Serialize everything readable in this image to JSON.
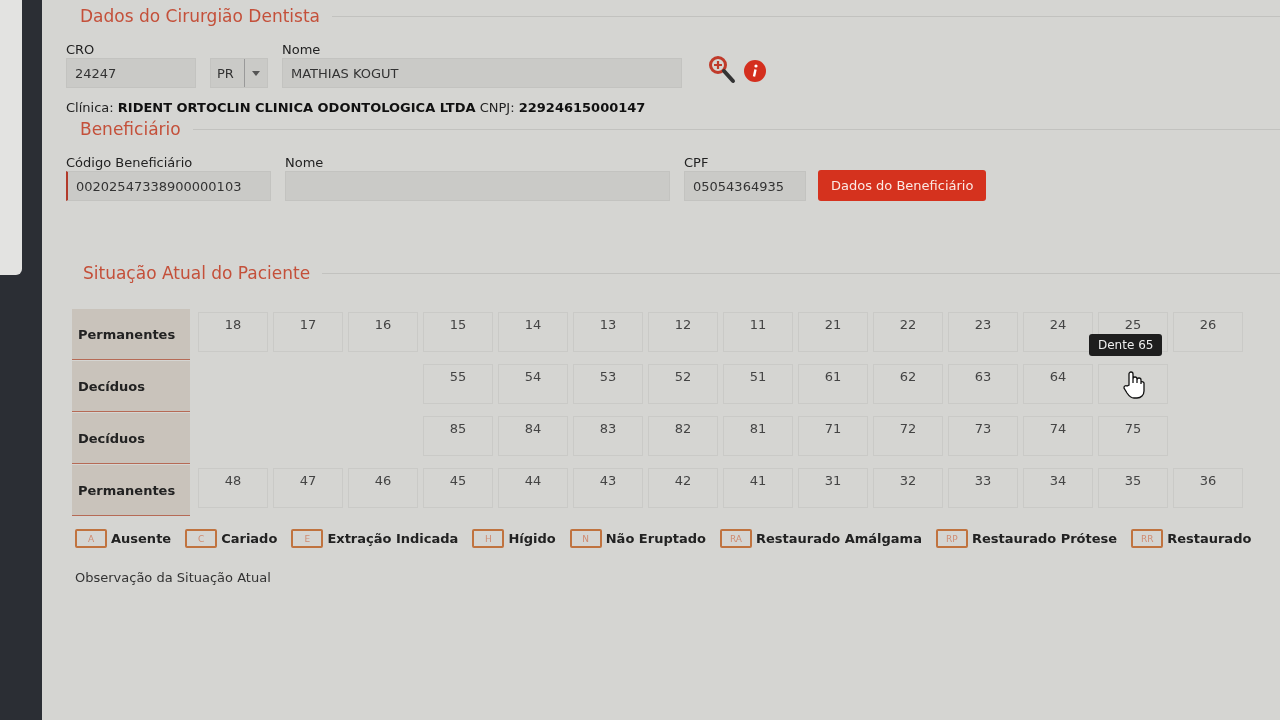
{
  "dentist_section": {
    "title": "Dados do Cirurgião Dentista",
    "cro": {
      "label": "CRO",
      "value": "24247"
    },
    "uf": {
      "value": "PR"
    },
    "name": {
      "label": "Nome",
      "value": "MATHIAS KOGUT"
    },
    "clinic_label": "Clínica:",
    "clinic_name": "RIDENT ORTOCLIN CLINICA ODONTOLOGICA LTDA",
    "cnpj_label": "CNPJ:",
    "cnpj": "22924615000147"
  },
  "beneficiary_section": {
    "title": "Beneficiário",
    "code": {
      "label": "Código Beneficiário",
      "value": "00202547338900000103"
    },
    "name": {
      "label": "Nome"
    },
    "cpf": {
      "label": "CPF",
      "value": "05054364935"
    },
    "button": "Dados do Beneficiário"
  },
  "patient_section": {
    "title": "Situação Atual do Paciente",
    "rows": [
      {
        "label": "Permanentes",
        "cells": [
          {
            "kind": "tooth",
            "number": "18"
          },
          {
            "kind": "tooth",
            "number": "17"
          },
          {
            "kind": "tooth",
            "number": "16"
          },
          {
            "kind": "tooth",
            "number": "15"
          },
          {
            "kind": "tooth",
            "number": "14"
          },
          {
            "kind": "tooth",
            "number": "13"
          },
          {
            "kind": "tooth",
            "number": "12"
          },
          {
            "kind": "tooth",
            "number": "11"
          },
          {
            "kind": "tooth",
            "number": "21"
          },
          {
            "kind": "tooth",
            "number": "22"
          },
          {
            "kind": "tooth",
            "number": "23"
          },
          {
            "kind": "tooth",
            "number": "24"
          },
          {
            "kind": "tooth",
            "number": "25"
          },
          {
            "kind": "tooth",
            "number": "26"
          }
        ]
      },
      {
        "label": "Decíduos",
        "cells": [
          {
            "kind": "empty"
          },
          {
            "kind": "empty"
          },
          {
            "kind": "empty"
          },
          {
            "kind": "tooth",
            "number": "55"
          },
          {
            "kind": "tooth",
            "number": "54"
          },
          {
            "kind": "tooth",
            "number": "53"
          },
          {
            "kind": "tooth",
            "number": "52"
          },
          {
            "kind": "tooth",
            "number": "51"
          },
          {
            "kind": "tooth",
            "number": "61"
          },
          {
            "kind": "tooth",
            "number": "62"
          },
          {
            "kind": "tooth",
            "number": "63"
          },
          {
            "kind": "tooth",
            "number": "64"
          },
          {
            "kind": "hovered",
            "tooltip": "Dente 65"
          },
          {
            "kind": "empty"
          }
        ]
      },
      {
        "label": "Decíduos",
        "cells": [
          {
            "kind": "empty"
          },
          {
            "kind": "empty"
          },
          {
            "kind": "empty"
          },
          {
            "kind": "tooth",
            "number": "85"
          },
          {
            "kind": "tooth",
            "number": "84"
          },
          {
            "kind": "tooth",
            "number": "83"
          },
          {
            "kind": "tooth",
            "number": "82"
          },
          {
            "kind": "tooth",
            "number": "81"
          },
          {
            "kind": "tooth",
            "number": "71"
          },
          {
            "kind": "tooth",
            "number": "72"
          },
          {
            "kind": "tooth",
            "number": "73"
          },
          {
            "kind": "tooth",
            "number": "74"
          },
          {
            "kind": "tooth",
            "number": "75"
          },
          {
            "kind": "empty"
          }
        ]
      },
      {
        "label": "Permanentes",
        "cells": [
          {
            "kind": "tooth",
            "number": "48"
          },
          {
            "kind": "tooth",
            "number": "47"
          },
          {
            "kind": "tooth",
            "number": "46"
          },
          {
            "kind": "tooth",
            "number": "45"
          },
          {
            "kind": "tooth",
            "number": "44"
          },
          {
            "kind": "tooth",
            "number": "43"
          },
          {
            "kind": "tooth",
            "number": "42"
          },
          {
            "kind": "tooth",
            "number": "41"
          },
          {
            "kind": "tooth",
            "number": "31"
          },
          {
            "kind": "tooth",
            "number": "32"
          },
          {
            "kind": "tooth",
            "number": "33"
          },
          {
            "kind": "tooth",
            "number": "34"
          },
          {
            "kind": "tooth",
            "number": "35"
          },
          {
            "kind": "tooth",
            "number": "36"
          }
        ]
      }
    ],
    "legend": [
      {
        "code": "A",
        "label": "Ausente"
      },
      {
        "code": "C",
        "label": "Cariado"
      },
      {
        "code": "E",
        "label": "Extração Indicada"
      },
      {
        "code": "H",
        "label": "Hígido"
      },
      {
        "code": "N",
        "label": "Não Eruptado"
      },
      {
        "code": "RA",
        "label": "Restaurado Amálgama"
      },
      {
        "code": "RP",
        "label": "Restaurado Prótese"
      },
      {
        "code": "RR",
        "label": "Restaurado"
      }
    ],
    "observation_label": "Observação da Situação Atual"
  }
}
